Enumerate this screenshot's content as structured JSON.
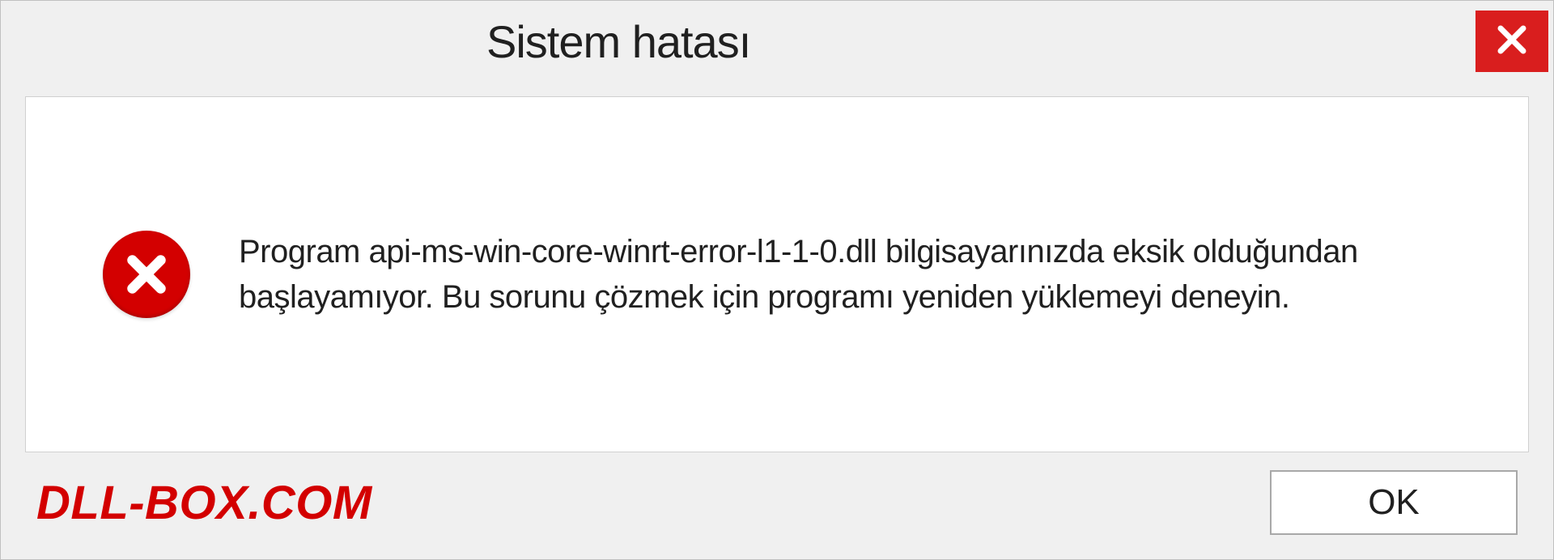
{
  "dialog": {
    "title": "Sistem hatası",
    "message": "Program api-ms-win-core-winrt-error-l1-1-0.dll bilgisayarınızda eksik olduğundan başlayamıyor. Bu sorunu çözmek için programı yeniden yüklemeyi deneyin.",
    "ok_label": "OK",
    "watermark": "DLL-BOX.COM"
  },
  "colors": {
    "error_red": "#d30000",
    "close_red": "#d91e1e"
  }
}
